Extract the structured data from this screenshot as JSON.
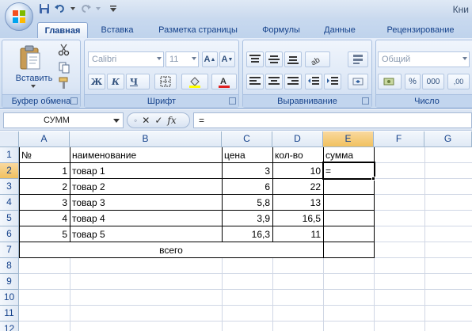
{
  "title_bar": {
    "title_fragment": "Кни"
  },
  "tabs": [
    "Главная",
    "Вставка",
    "Разметка страницы",
    "Формулы",
    "Данные",
    "Рецензирование"
  ],
  "ribbon": {
    "clipboard": {
      "label": "Буфер обмена",
      "paste_label": "Вставить"
    },
    "font": {
      "label": "Шрифт",
      "font_name": "Calibri",
      "font_size": "11",
      "bold": "Ж",
      "italic": "К",
      "underline": "Ч"
    },
    "alignment": {
      "label": "Выравнивание"
    },
    "number": {
      "label": "Число",
      "format": "Общий"
    }
  },
  "formula_bar": {
    "name_box": "СУММ",
    "formula": "=",
    "fx": "fx"
  },
  "columns": [
    "A",
    "B",
    "C",
    "D",
    "E",
    "F",
    "G"
  ],
  "rows": [
    "1",
    "2",
    "3",
    "4",
    "5",
    "6",
    "7",
    "8",
    "9",
    "10",
    "11",
    "12"
  ],
  "sheet": {
    "header": {
      "a": "№",
      "b": "наименование",
      "c": "цена",
      "d": "кол-во",
      "e": "сумма"
    },
    "items": [
      {
        "a": "1",
        "b": "товар 1",
        "c": "3",
        "d": "10",
        "e": "="
      },
      {
        "a": "2",
        "b": "товар 2",
        "c": "6",
        "d": "22",
        "e": ""
      },
      {
        "a": "3",
        "b": "товар 3",
        "c": "5,8",
        "d": "13",
        "e": ""
      },
      {
        "a": "4",
        "b": "товар 4",
        "c": "3,9",
        "d": "16,5",
        "e": ""
      },
      {
        "a": "5",
        "b": "товар 5",
        "c": "16,3",
        "d": "11",
        "e": ""
      }
    ],
    "total_label": "всего"
  },
  "active": {
    "cell": "E2",
    "column": "E",
    "row": "2"
  }
}
